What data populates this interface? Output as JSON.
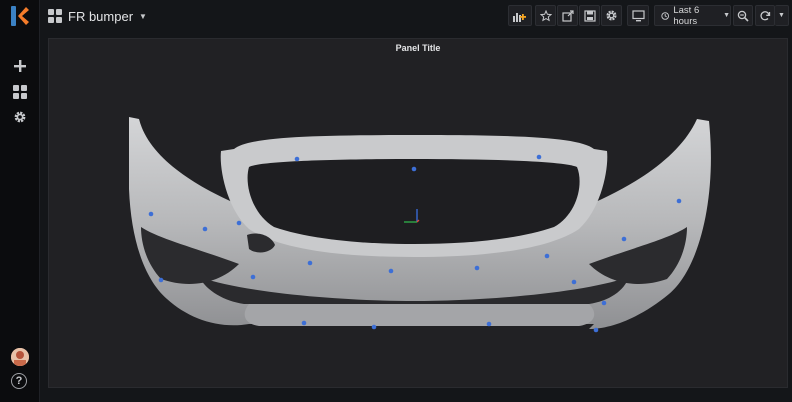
{
  "app": {
    "dashboard_title": "FR bumper",
    "time_range_label": "Last 6 hours"
  },
  "panel": {
    "title": "Panel Title"
  },
  "sidebar": {
    "items": [
      {
        "name": "add",
        "icon": "plus-icon"
      },
      {
        "name": "dashboards",
        "icon": "dashboards-grid-icon"
      },
      {
        "name": "configuration",
        "icon": "gear-icon"
      }
    ],
    "bottom": [
      {
        "name": "profile",
        "icon": "avatar"
      },
      {
        "name": "help",
        "icon": "help-icon",
        "glyph": "?"
      }
    ]
  },
  "toolbar": {
    "buttons": [
      {
        "name": "add-panel",
        "icon": "add-panel-icon"
      },
      {
        "name": "star",
        "icon": "star-icon"
      },
      {
        "name": "share",
        "icon": "share-icon"
      },
      {
        "name": "save",
        "icon": "save-icon"
      },
      {
        "name": "settings",
        "icon": "gear-icon"
      },
      {
        "name": "tv-mode",
        "icon": "monitor-icon"
      },
      {
        "name": "time-picker",
        "icon": "clock-icon"
      },
      {
        "name": "zoom-out",
        "icon": "zoom-out-icon"
      },
      {
        "name": "refresh",
        "icon": "refresh-icon"
      },
      {
        "name": "refresh-interval",
        "icon": "caret-down-icon"
      }
    ]
  },
  "colors": {
    "background": "#141619",
    "sidebar": "#0b0c0e",
    "panel": "#212124",
    "bumper": "#b9babc",
    "marker": "#3d6fd6",
    "logo_orange": "#f47c2a",
    "logo_blue": "#3b82c4"
  }
}
